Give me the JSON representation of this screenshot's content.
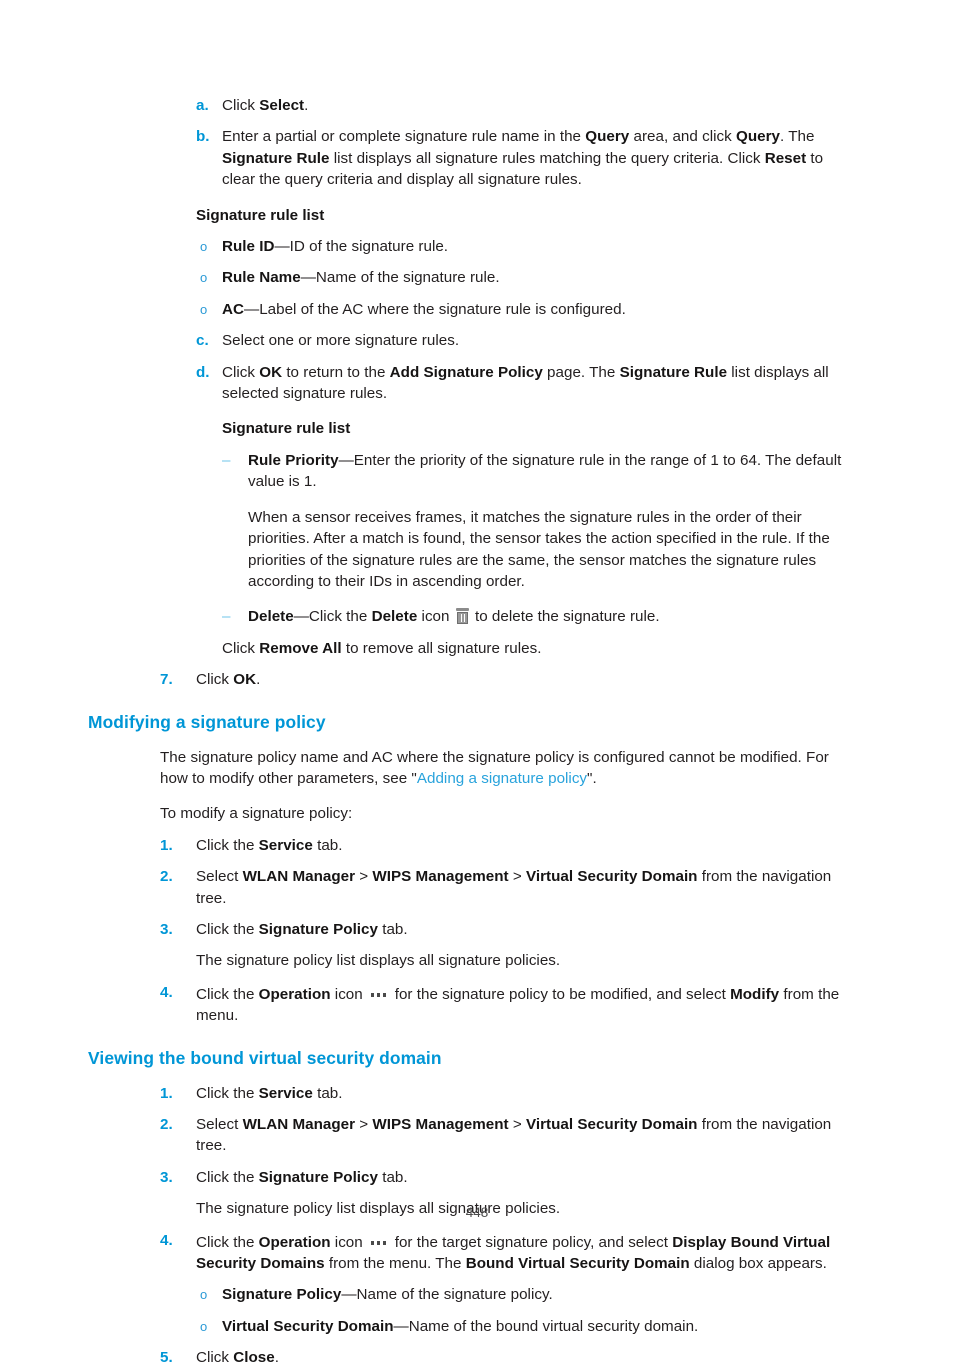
{
  "document": {
    "page_number": "448",
    "accent_color": "#0096d6",
    "link_color": "#29a3dc",
    "body_color": "#231f20",
    "dash_color": "#6fc4e8"
  },
  "content": {
    "step_a": {
      "marker": "a.",
      "text_1": "Click ",
      "bold_1": "Select",
      "text_2": "."
    },
    "step_b": {
      "marker": "b.",
      "text_1": "Enter a partial or complete signature rule name in the ",
      "bold_1": "Query",
      "text_2": " area, and click ",
      "bold_2": "Query",
      "text_3": ". The ",
      "bold_3": "Signature Rule",
      "text_4": " list displays all signature rules matching the query criteria. Click ",
      "bold_4": "Reset",
      "text_5": " to clear the query criteria and display all signature rules."
    },
    "sig_rule_list_label_1": "Signature rule list",
    "bullet_rule_id": {
      "marker": "o",
      "bold": "Rule ID",
      "text": "—ID of the signature rule."
    },
    "bullet_rule_name": {
      "marker": "o",
      "bold": "Rule Name",
      "text": "—Name of the signature rule."
    },
    "bullet_ac": {
      "marker": "o",
      "bold": "AC",
      "text": "—Label of the AC where the signature rule is configured."
    },
    "step_c": {
      "marker": "c.",
      "text": "Select one or more signature rules."
    },
    "step_d": {
      "marker": "d.",
      "text_1": "Click ",
      "bold_1": "OK",
      "text_2": " to return to the ",
      "bold_2": "Add Signature Policy",
      "text_3": " page. The ",
      "bold_3": "Signature Rule",
      "text_4": " list displays all selected signature rules."
    },
    "sig_rule_list_label_2": "Signature rule list",
    "dash_rule_priority": {
      "marker": "–",
      "bold": "Rule Priority",
      "text": "—Enter the priority of the signature rule in the range of 1 to 64. The default value is 1."
    },
    "priority_explanation": "When a sensor receives frames, it matches the signature rules in the order of their priorities. After a match is found, the sensor takes the action specified in the rule. If the priorities of the signature rules are the same, the sensor matches the signature rules according to their IDs in ascending order.",
    "dash_delete": {
      "marker": "–",
      "bold_1": "Delete",
      "text_1": "—Click the ",
      "bold_2": "Delete",
      "text_2": " icon ",
      "icon": "trash-icon",
      "text_3": " to delete the signature rule."
    },
    "remove_all": {
      "text_1": "Click ",
      "bold_1": "Remove All",
      "text_2": " to remove all signature rules."
    },
    "step_7": {
      "marker": "7.",
      "text_1": "Click ",
      "bold_1": "OK",
      "text_2": "."
    },
    "heading_modifying": "Modifying a signature policy",
    "modifying_intro": {
      "text_1": "The signature policy name and AC where the signature policy is configured cannot be modified. For how to modify other parameters, see \"",
      "link": "Adding a signature policy",
      "text_2": "\"."
    },
    "to_modify_lead": "To modify a signature policy:",
    "mod_step_1": {
      "marker": "1.",
      "text_1": "Click the ",
      "bold_1": "Service",
      "text_2": " tab."
    },
    "mod_step_2": {
      "marker": "2.",
      "text_1": "Select ",
      "bold_1": "WLAN Manager",
      "text_2": " > ",
      "bold_2": "WIPS Management",
      "text_3": " > ",
      "bold_3": "Virtual Security Domain",
      "text_4": " from the navigation tree."
    },
    "mod_step_3": {
      "marker": "3.",
      "text_1": "Click the ",
      "bold_1": "Signature Policy",
      "text_2": " tab."
    },
    "mod_step_3_note": "The signature policy list displays all signature policies.",
    "mod_step_4": {
      "marker": "4.",
      "text_1": "Click the ",
      "bold_1": "Operation",
      "text_2": " icon ",
      "icon": "operation-dots-icon",
      "text_3": " for the signature policy to be modified, and select ",
      "bold_2": "Modify",
      "text_4": " from the menu."
    },
    "heading_viewing": "Viewing the bound virtual security domain",
    "view_step_1": {
      "marker": "1.",
      "text_1": "Click the ",
      "bold_1": "Service",
      "text_2": " tab."
    },
    "view_step_2": {
      "marker": "2.",
      "text_1": "Select ",
      "bold_1": "WLAN Manager",
      "text_2": " > ",
      "bold_2": "WIPS Management",
      "text_3": " > ",
      "bold_3": "Virtual Security Domain",
      "text_4": " from the navigation tree."
    },
    "view_step_3": {
      "marker": "3.",
      "text_1": "Click the ",
      "bold_1": "Signature Policy",
      "text_2": " tab."
    },
    "view_step_3_note": "The signature policy list displays all signature policies.",
    "view_step_4": {
      "marker": "4.",
      "text_1": "Click the ",
      "bold_1": "Operation",
      "text_2": " icon ",
      "icon": "operation-dots-icon",
      "text_3": " for the target signature policy, and select ",
      "bold_2": "Display Bound Virtual Security Domains",
      "text_4": " from the menu. The ",
      "bold_3": "Bound Virtual Security Domain",
      "text_5": " dialog box appears."
    },
    "view_bullet_policy": {
      "marker": "o",
      "bold": "Signature Policy",
      "text": "—Name of the signature policy."
    },
    "view_bullet_vsd": {
      "marker": "o",
      "bold": "Virtual Security Domain",
      "text": "—Name of the bound virtual security domain."
    },
    "view_step_5": {
      "marker": "5.",
      "text_1": "Click ",
      "bold_1": "Close",
      "text_2": "."
    }
  }
}
